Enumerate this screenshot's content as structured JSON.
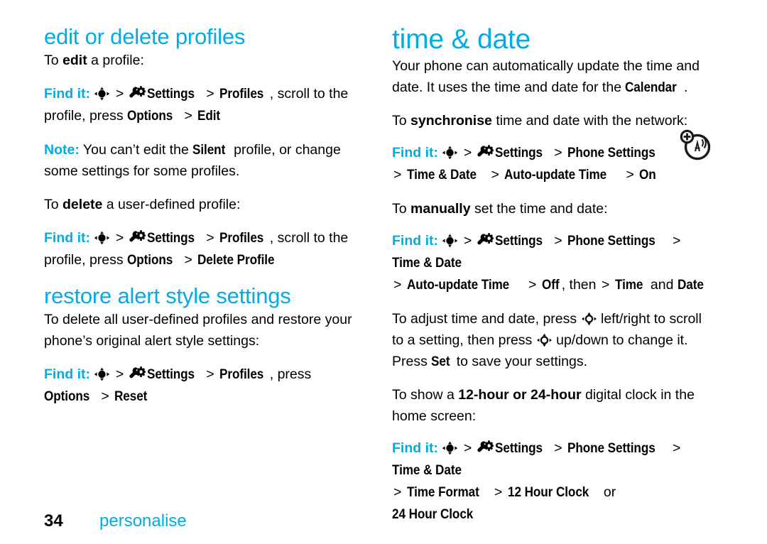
{
  "page": {
    "number": "34",
    "footer_title": "personalise",
    "accent_color": "#00ace6",
    "text_color": "#000000",
    "background": "#ffffff"
  },
  "left_column": {
    "heading": "edit or delete profiles",
    "edit_intro": {
      "pre": "To ",
      "bold": "edit",
      "post": " a profile:"
    },
    "edit_findit": {
      "label": "Find it:",
      "nav_icon": "navigation-key-icon",
      "sep1": ">",
      "settings_icon": "settings-gear-icon",
      "item1": "Settings",
      "sep2": ">",
      "item2": "Profiles",
      "plain1": ", scroll to the profile,",
      "plain2": "press ",
      "item3": "Options",
      "sep3": ">",
      "item4": "Edit"
    },
    "note": {
      "label": "Note:",
      "text_pre": " You can’t edit the ",
      "bold": "Silent",
      "text_post": " profile, or change some settings for some profiles."
    },
    "delete_intro": {
      "pre": "To ",
      "bold": "delete",
      "post": " a user-defined profile:"
    },
    "delete_findit": {
      "label": "Find it:",
      "item1": "Settings",
      "item2": "Profiles",
      "plain1": ", scroll to the profile,",
      "plain2": "press ",
      "item3": "Options",
      "item4": "Delete Profile"
    },
    "heading2": "restore alert style settings",
    "restore_intro": "To delete all user-defined profiles and restore your phone’s original alert style settings:",
    "restore_findit": {
      "label": "Find it:",
      "item1": "Settings",
      "item2": "Profiles",
      "plain1": ", press ",
      "item3": "Options",
      "item4": "Reset"
    }
  },
  "right_column": {
    "heading": "time & date",
    "intro": {
      "pre": "Your phone can automatically update the time and date. It uses the time and date for the ",
      "bold": "Calendar",
      "post": "."
    },
    "sync_intro": {
      "pre": "To ",
      "bold": "synchronise",
      "post": " time and date with the network:"
    },
    "network_icon": "network-auto-update-icon",
    "sync_findit": {
      "label": "Find it:",
      "item1": "Settings",
      "item2": "Phone Settings",
      "item3": "Time & Date",
      "item4": "Auto-update Time",
      "item5": "On"
    },
    "manual_intro": {
      "pre": "To ",
      "bold": "manually",
      "post": " set the time and date:"
    },
    "manual_findit": {
      "label": "Find it:",
      "item1": "Settings",
      "item2": "Phone Settings",
      "item3": "Time & Date",
      "item4": "Auto-update Time",
      "item5": "Off",
      "then": ", then ",
      "item6": "Time",
      "and": " and ",
      "item7": "Date"
    },
    "adjust": {
      "part1": "To adjust time and date, press ",
      "part2": " left/right to scroll to a setting, then press ",
      "part3": " up/down to change it. Press ",
      "bold": "Set",
      "part4": " to save your settings."
    },
    "clock_intro": {
      "pre": "To show a ",
      "bold": "12-hour or 24-hour",
      "post": " digital clock in the home screen:"
    },
    "clock_findit": {
      "label": "Find it:",
      "item1": "Settings",
      "item2": "Phone Settings",
      "item3": "Time & Date",
      "item4": "Time Format",
      "item5": "12 Hour Clock",
      "or": " or ",
      "item6": "24 Hour Clock"
    }
  },
  "symbols": {
    "gt": ">"
  }
}
